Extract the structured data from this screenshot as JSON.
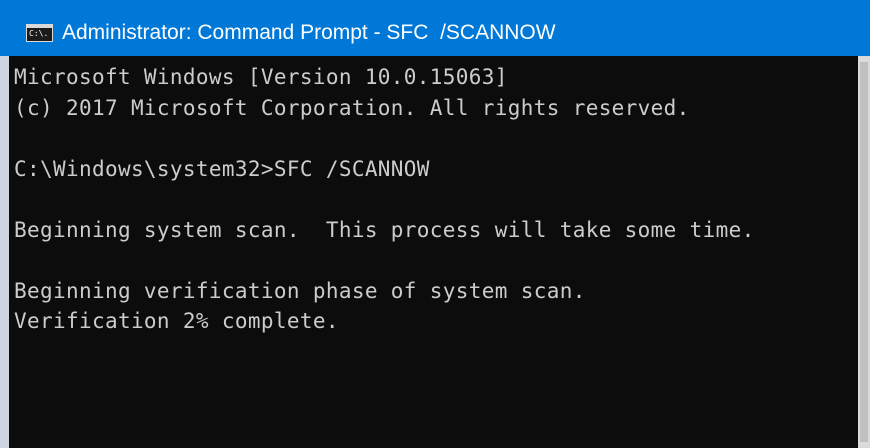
{
  "window": {
    "title": "Administrator: Command Prompt - SFC  /SCANNOW",
    "icon": "command-prompt-icon",
    "icon_glyph": "C:\\."
  },
  "console": {
    "lines": [
      "Microsoft Windows [Version 10.0.15063]",
      "(c) 2017 Microsoft Corporation. All rights reserved.",
      "",
      "C:\\Windows\\system32>SFC /SCANNOW",
      "",
      "Beginning system scan.  This process will take some time.",
      "",
      "Beginning verification phase of system scan.",
      "Verification 2% complete.",
      "",
      ""
    ]
  },
  "colors": {
    "titlebar": "#0078d7",
    "console_bg": "#0c0c0c",
    "console_text": "#cccccc"
  }
}
